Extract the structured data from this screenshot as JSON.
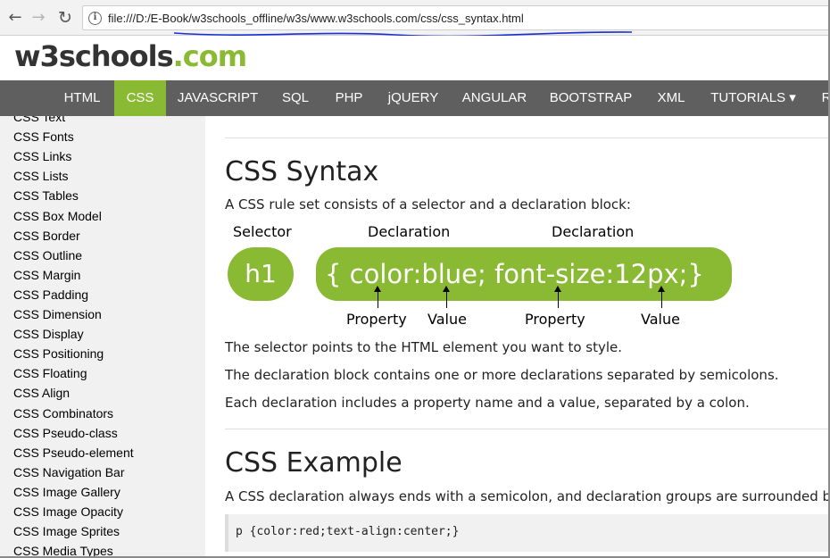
{
  "browser": {
    "url": "file:///D:/E-Book/w3schools_offline/w3s/www.w3schools.com/css/css_syntax.html"
  },
  "logo": {
    "part1": "w3schools",
    "part2": ".com"
  },
  "colors": {
    "accent": "#8ab933",
    "nav_bg": "#5f5f5f",
    "sidebar_bg": "#f1f1f1",
    "annotation_ink": "#1a2fd0"
  },
  "topnav": [
    "HTML",
    "CSS",
    "JAVASCRIPT",
    "SQL",
    "PHP",
    "jQUERY",
    "ANGULAR",
    "BOOTSTRAP",
    "XML",
    "TUTORIALS ▾",
    "R"
  ],
  "topnav_active": "CSS",
  "sidebar": [
    "CSS Text",
    "CSS Fonts",
    "CSS Links",
    "CSS Lists",
    "CSS Tables",
    "CSS Box Model",
    "CSS Border",
    "CSS Outline",
    "CSS Margin",
    "CSS Padding",
    "CSS Dimension",
    "CSS Display",
    "CSS Positioning",
    "CSS Floating",
    "CSS Align",
    "CSS Combinators",
    "CSS Pseudo-class",
    "CSS Pseudo-element",
    "CSS Navigation Bar",
    "CSS Image Gallery",
    "CSS Image Opacity",
    "CSS Image Sprites",
    "CSS Media Types"
  ],
  "main": {
    "syntax_title": "CSS Syntax",
    "syntax_intro": "A CSS rule set consists of a selector and a declaration block:",
    "diagram": {
      "selector_label": "Selector",
      "declaration_label_1": "Declaration",
      "declaration_label_2": "Declaration",
      "selector": "h1",
      "declaration": "{ color:blue; font-size:12px;}",
      "property_1": "Property",
      "value_1": "Value",
      "property_2": "Property",
      "value_2": "Value"
    },
    "para1": "The selector points to the HTML element you want to style.",
    "para2": "The declaration block contains one or more declarations separated by semicolons.",
    "para3": "Each declaration includes a property name and a value, separated by a colon.",
    "example_title": "CSS Example",
    "example_intro": "A CSS declaration always ends with a semicolon, and declaration groups are surrounded by",
    "code": "p {color:red;text-align:center;}"
  }
}
